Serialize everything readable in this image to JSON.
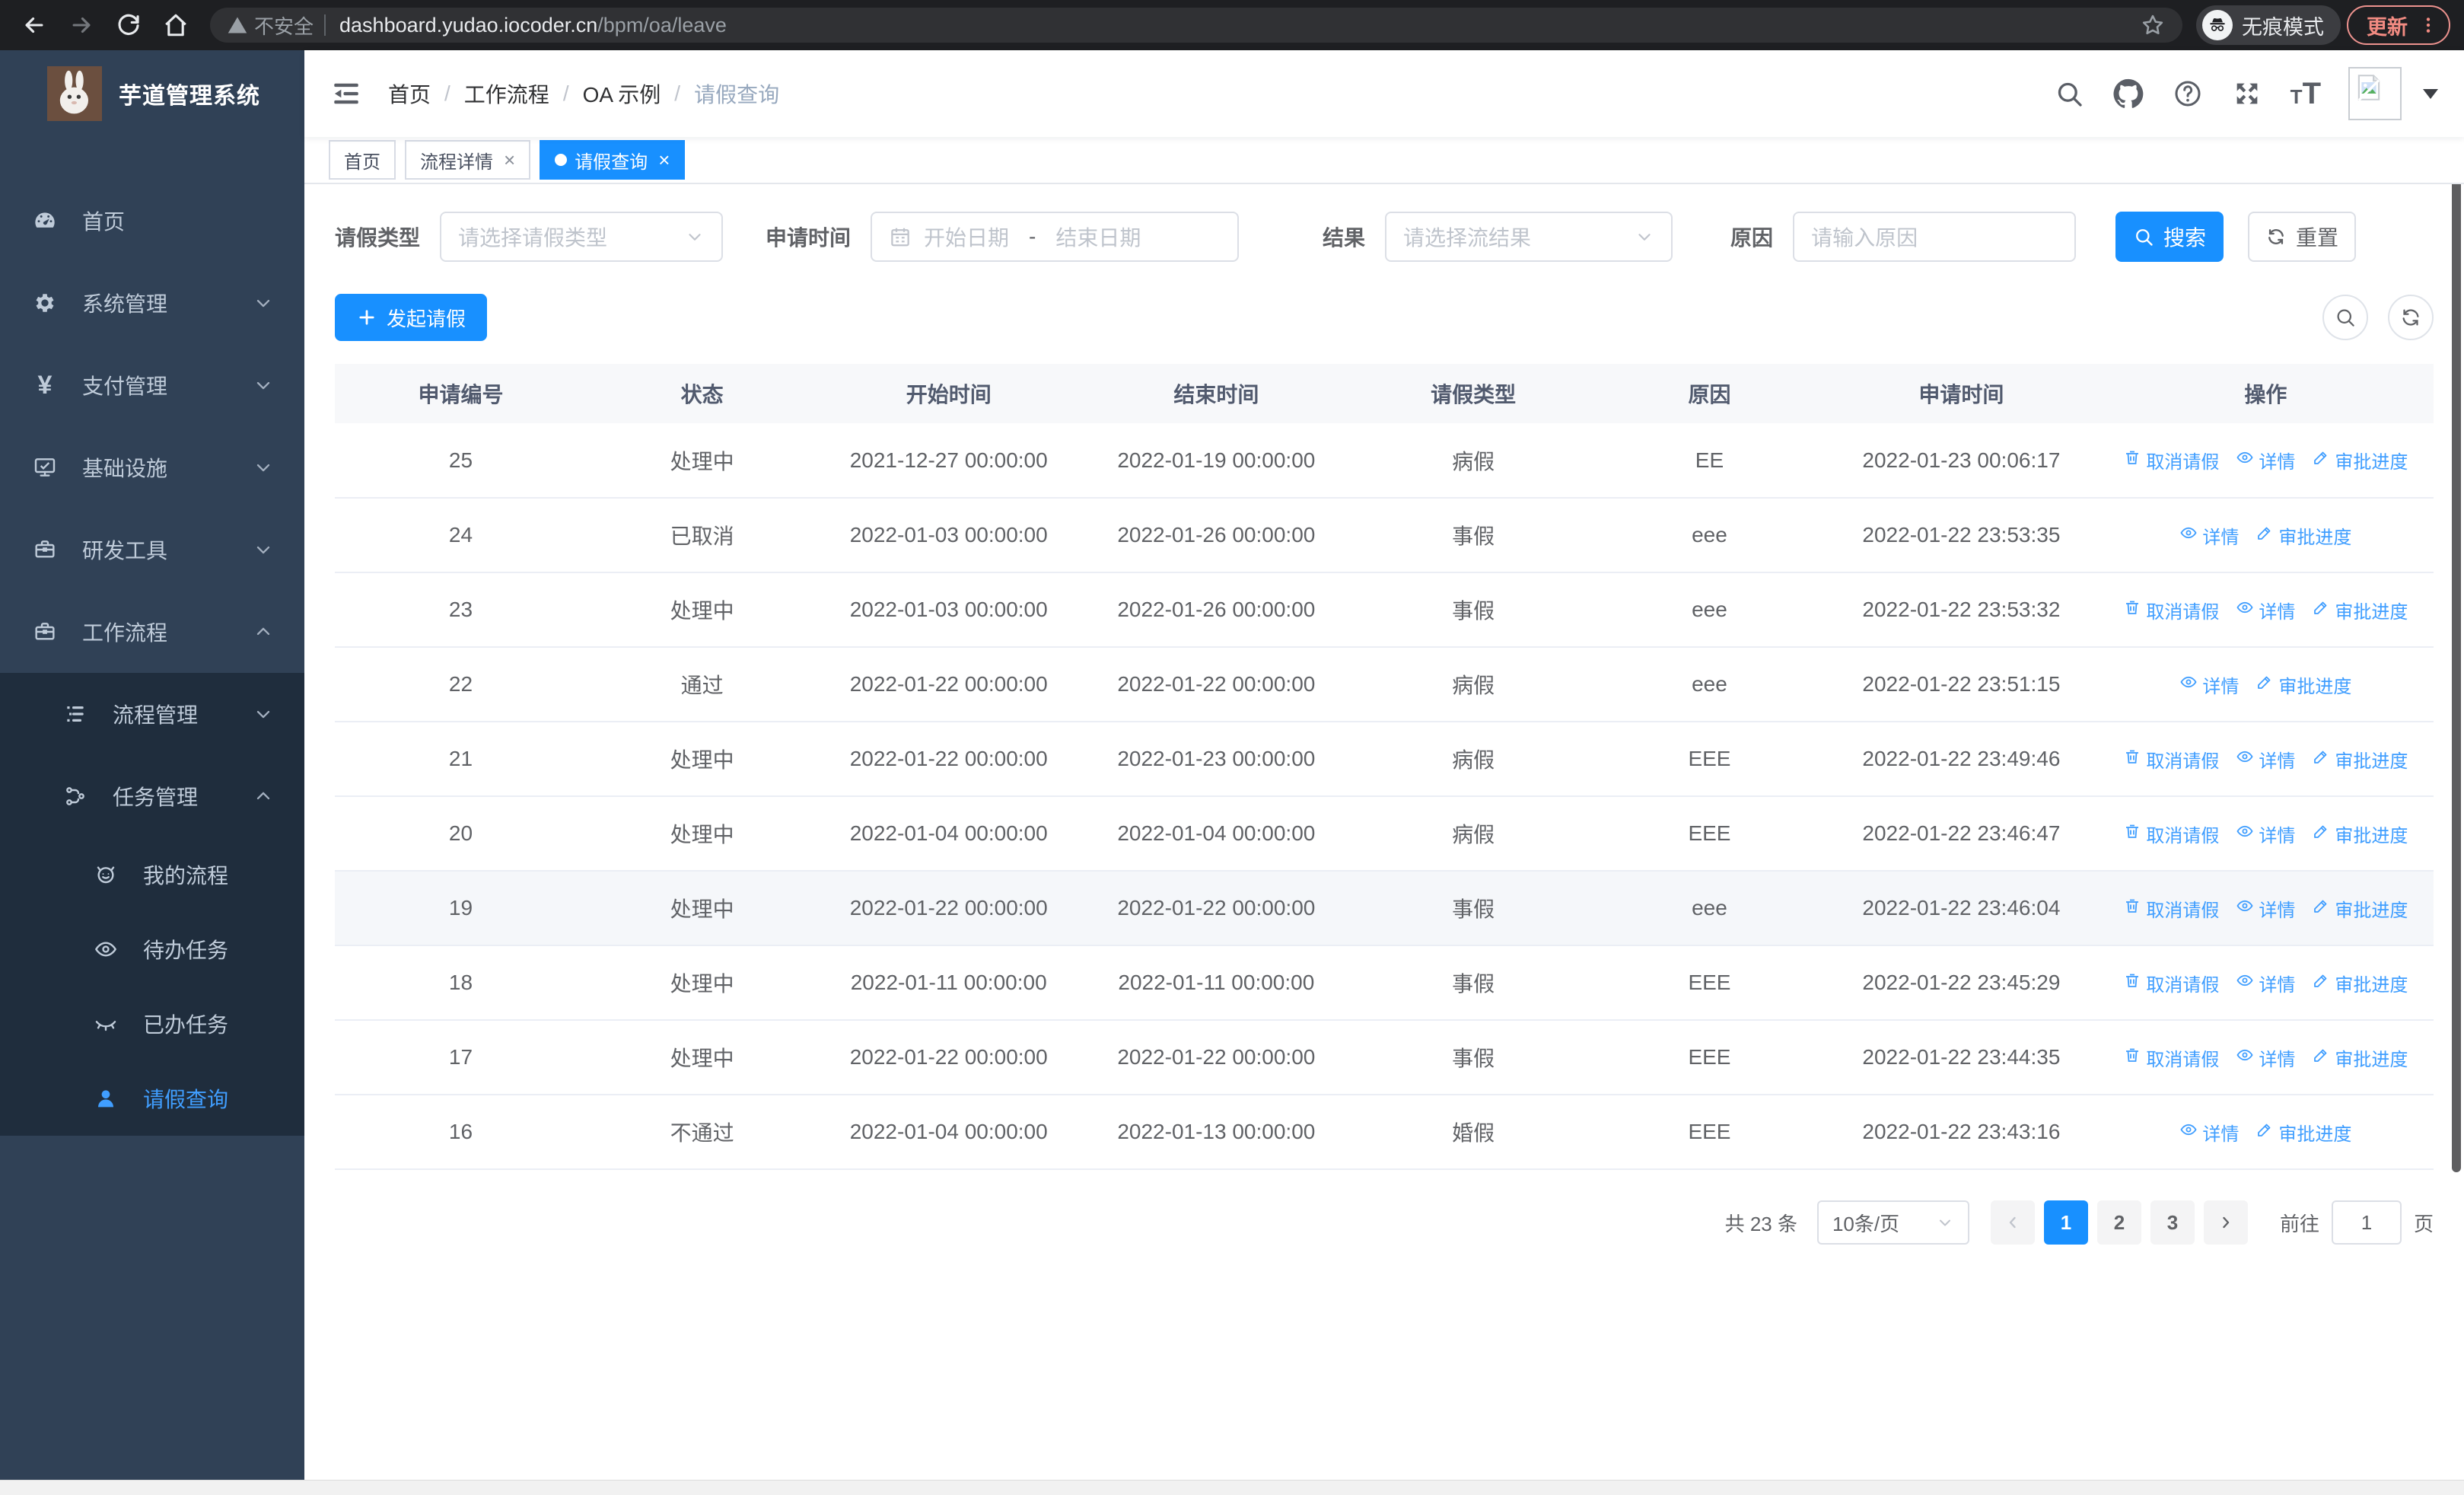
{
  "theme": {
    "primary": "#1890ff",
    "link": "#409eff",
    "sidebar_bg": "#304156",
    "submenu_bg": "#1f2d3d",
    "sidebar_text": "#bfcbd9"
  },
  "browser": {
    "security_label": "不安全",
    "url_host": "dashboard.yudao.iocoder.cn",
    "url_path": "/bpm/oa/leave",
    "incognito_label": "无痕模式",
    "update_label": "更新"
  },
  "sidebar": {
    "title": "芋道管理系统",
    "items": [
      {
        "key": "home",
        "label": "首页",
        "icon": "dashboard-icon",
        "level": 1,
        "submenu": false,
        "chevron": ""
      },
      {
        "key": "system-mgmt",
        "label": "系统管理",
        "icon": "gear-icon",
        "level": 1,
        "submenu": false,
        "chevron": "down"
      },
      {
        "key": "pay-mgmt",
        "label": "支付管理",
        "icon": "yen-icon",
        "level": 1,
        "submenu": false,
        "chevron": "down"
      },
      {
        "key": "infrastructure",
        "label": "基础设施",
        "icon": "monitor-icon",
        "level": 1,
        "submenu": false,
        "chevron": "down"
      },
      {
        "key": "dev-tools",
        "label": "研发工具",
        "icon": "toolbox-icon",
        "level": 1,
        "submenu": false,
        "chevron": "down"
      },
      {
        "key": "workflow",
        "label": "工作流程",
        "icon": "briefcase-icon",
        "level": 1,
        "submenu": false,
        "chevron": "up"
      },
      {
        "key": "process-mgmt",
        "label": "流程管理",
        "icon": "list-icon",
        "level": 2,
        "submenu": true,
        "chevron": "down"
      },
      {
        "key": "task-mgmt",
        "label": "任务管理",
        "icon": "tree-icon",
        "level": 2,
        "submenu": true,
        "chevron": "up"
      },
      {
        "key": "my-process",
        "label": "我的流程",
        "icon": "face-icon",
        "level": 3,
        "submenu": true,
        "chevron": ""
      },
      {
        "key": "todo-task",
        "label": "待办任务",
        "icon": "eye-icon",
        "level": 3,
        "submenu": true,
        "chevron": ""
      },
      {
        "key": "done-task",
        "label": "已办任务",
        "icon": "eye-closed-icon",
        "level": 3,
        "submenu": true,
        "chevron": ""
      },
      {
        "key": "leave-query",
        "label": "请假查询",
        "icon": "user-icon",
        "level": 3,
        "submenu": true,
        "chevron": "",
        "active": true
      }
    ]
  },
  "breadcrumb": {
    "items": [
      "首页",
      "工作流程",
      "OA 示例",
      "请假查询"
    ]
  },
  "tabs": {
    "items": [
      {
        "label": "首页",
        "active": false,
        "closable": false
      },
      {
        "label": "流程详情",
        "active": false,
        "closable": true
      },
      {
        "label": "请假查询",
        "active": true,
        "closable": true
      }
    ]
  },
  "filters": {
    "leave_type_label": "请假类型",
    "leave_type_placeholder": "请选择请假类型",
    "apply_time_label": "申请时间",
    "start_date_placeholder": "开始日期",
    "date_separator": "-",
    "end_date_placeholder": "结束日期",
    "result_label": "结果",
    "result_placeholder": "请选择流结果",
    "reason_label": "原因",
    "reason_placeholder": "请输入原因",
    "search_label": "搜索",
    "reset_label": "重置"
  },
  "toolbar": {
    "create_label": "发起请假"
  },
  "actions_labels": {
    "cancel": "取消请假",
    "detail": "详情",
    "progress": "审批进度"
  },
  "table": {
    "columns": [
      "申请编号",
      "状态",
      "开始时间",
      "结束时间",
      "请假类型",
      "原因",
      "申请时间",
      "操作"
    ],
    "col_widths": [
      "12%",
      "11%",
      "12.5%",
      "13%",
      "11.5%",
      "11%",
      "13%",
      "16%"
    ],
    "rows": [
      {
        "id": "25",
        "status": "处理中",
        "start": "2021-12-27 00:00:00",
        "end": "2022-01-19 00:00:00",
        "type": "病假",
        "reason": "EE",
        "applied": "2022-01-23 00:06:17",
        "actions": [
          "cancel",
          "detail",
          "progress"
        ],
        "highlight": false
      },
      {
        "id": "24",
        "status": "已取消",
        "start": "2022-01-03 00:00:00",
        "end": "2022-01-26 00:00:00",
        "type": "事假",
        "reason": "eee",
        "applied": "2022-01-22 23:53:35",
        "actions": [
          "detail",
          "progress"
        ],
        "highlight": false
      },
      {
        "id": "23",
        "status": "处理中",
        "start": "2022-01-03 00:00:00",
        "end": "2022-01-26 00:00:00",
        "type": "事假",
        "reason": "eee",
        "applied": "2022-01-22 23:53:32",
        "actions": [
          "cancel",
          "detail",
          "progress"
        ],
        "highlight": false
      },
      {
        "id": "22",
        "status": "通过",
        "start": "2022-01-22 00:00:00",
        "end": "2022-01-22 00:00:00",
        "type": "病假",
        "reason": "eee",
        "applied": "2022-01-22 23:51:15",
        "actions": [
          "detail",
          "progress"
        ],
        "highlight": false
      },
      {
        "id": "21",
        "status": "处理中",
        "start": "2022-01-22 00:00:00",
        "end": "2022-01-23 00:00:00",
        "type": "病假",
        "reason": "EEE",
        "applied": "2022-01-22 23:49:46",
        "actions": [
          "cancel",
          "detail",
          "progress"
        ],
        "highlight": false
      },
      {
        "id": "20",
        "status": "处理中",
        "start": "2022-01-04 00:00:00",
        "end": "2022-01-04 00:00:00",
        "type": "病假",
        "reason": "EEE",
        "applied": "2022-01-22 23:46:47",
        "actions": [
          "cancel",
          "detail",
          "progress"
        ],
        "highlight": false
      },
      {
        "id": "19",
        "status": "处理中",
        "start": "2022-01-22 00:00:00",
        "end": "2022-01-22 00:00:00",
        "type": "事假",
        "reason": "eee",
        "applied": "2022-01-22 23:46:04",
        "actions": [
          "cancel",
          "detail",
          "progress"
        ],
        "highlight": true
      },
      {
        "id": "18",
        "status": "处理中",
        "start": "2022-01-11 00:00:00",
        "end": "2022-01-11 00:00:00",
        "type": "事假",
        "reason": "EEE",
        "applied": "2022-01-22 23:45:29",
        "actions": [
          "cancel",
          "detail",
          "progress"
        ],
        "highlight": false
      },
      {
        "id": "17",
        "status": "处理中",
        "start": "2022-01-22 00:00:00",
        "end": "2022-01-22 00:00:00",
        "type": "事假",
        "reason": "EEE",
        "applied": "2022-01-22 23:44:35",
        "actions": [
          "cancel",
          "detail",
          "progress"
        ],
        "highlight": false
      },
      {
        "id": "16",
        "status": "不通过",
        "start": "2022-01-04 00:00:00",
        "end": "2022-01-13 00:00:00",
        "type": "婚假",
        "reason": "EEE",
        "applied": "2022-01-22 23:43:16",
        "actions": [
          "detail",
          "progress"
        ],
        "highlight": false
      }
    ]
  },
  "pagination": {
    "total_label": "共 23 条",
    "page_size": "10条/页",
    "pages": [
      "1",
      "2",
      "3"
    ],
    "active_page": "1",
    "goto_label": "前往",
    "goto_value": "1",
    "page_suffix": "页"
  }
}
